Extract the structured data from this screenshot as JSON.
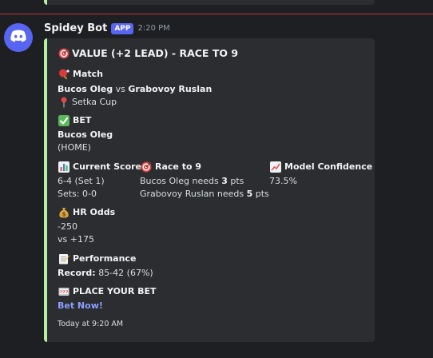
{
  "message": {
    "username": "Spidey Bot",
    "badge": "APP",
    "timestamp": "2:20 PM"
  },
  "embed": {
    "accent_color": "#b5f0a0",
    "title": "VALUE (+2 LEAD) - RACE TO 9",
    "match": {
      "label": "Match",
      "player1": "Bucos Oleg",
      "vs": " vs ",
      "player2": "Grabovoy Ruslan",
      "tournament": "Setka Cup"
    },
    "bet": {
      "label": "BET",
      "pick": "Bucos Oleg",
      "side": "(HOME)"
    },
    "current_score": {
      "label": "Current Score",
      "line1": "6-4 (Set 1)",
      "line2": "Sets: 0-0"
    },
    "race": {
      "label": "Race to 9",
      "p1_prefix": "Bucos Oleg needs ",
      "p1_value": "3",
      "p1_suffix": " pts",
      "p2_prefix": "Grabovoy Ruslan needs ",
      "p2_value": "5",
      "p2_suffix": " pts"
    },
    "confidence": {
      "label": "Model Confidence",
      "value": "73.5%"
    },
    "odds": {
      "label": "HR Odds",
      "line1": "-250",
      "line2": "vs +175"
    },
    "performance": {
      "label": "Performance",
      "record_label": "Record:",
      "record_value": " 85-42 (67%)"
    },
    "place_bet": {
      "label": "PLACE YOUR BET",
      "link": "Bet Now!"
    },
    "footer": "Today at 9:20 AM"
  },
  "icons": {
    "title": "direct-hit-icon",
    "match": "ping-pong-icon",
    "location": "round-pushpin-icon",
    "bet": "check-mark-button-icon",
    "score": "bar-chart-icon",
    "race": "direct-hit-icon",
    "confidence": "chart-increasing-icon",
    "odds": "money-bag-icon",
    "performance": "memo-icon",
    "place_bet": "slot-machine-icon"
  },
  "colors": {
    "background": "#1e1f22",
    "embed_bg": "#2b2d31",
    "accent": "#b5f0a0",
    "brand": "#5865f2",
    "link": "#8c9eff",
    "new_divider": "#f23f43"
  }
}
